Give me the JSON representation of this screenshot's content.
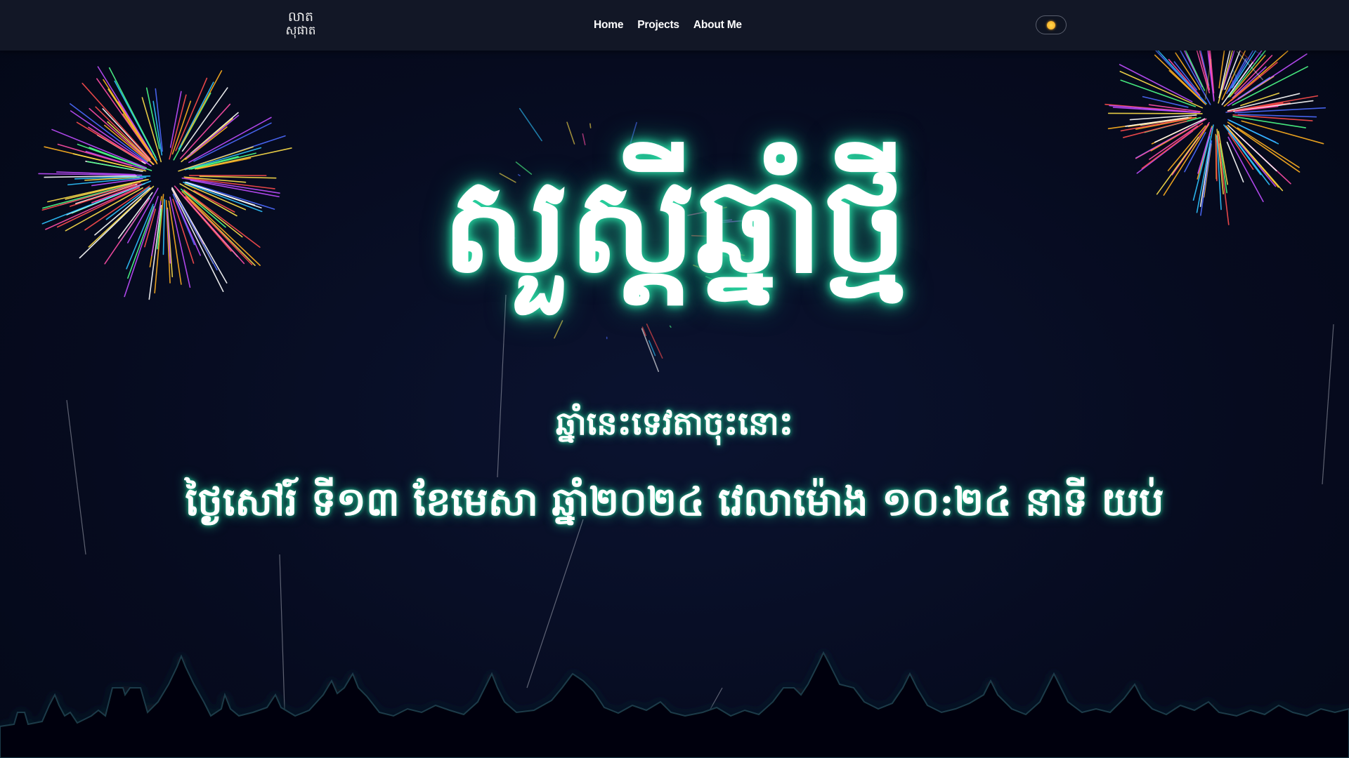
{
  "navbar": {
    "logo_line1": "លាត",
    "logo_line2": "សុផាត",
    "links": [
      "Home",
      "Projects",
      "About Me"
    ],
    "theme_toggle_icon": "sun-icon"
  },
  "hero": {
    "title": "សួស្តីឆ្នាំថ្មី",
    "subtitle": "ឆ្នាំនេះទេវតាចុះនោះ",
    "date_line": "ថ្ងៃសៅរ៍ ទី១៣ ខែមេសា ឆ្នាំ២០២៤ វេលាម៉ោង ១០:២៤ នាទី យប់"
  },
  "colors": {
    "background": "#060b1f",
    "navbar": "#121726",
    "glow": "#22c993",
    "text": "#ffffff"
  }
}
